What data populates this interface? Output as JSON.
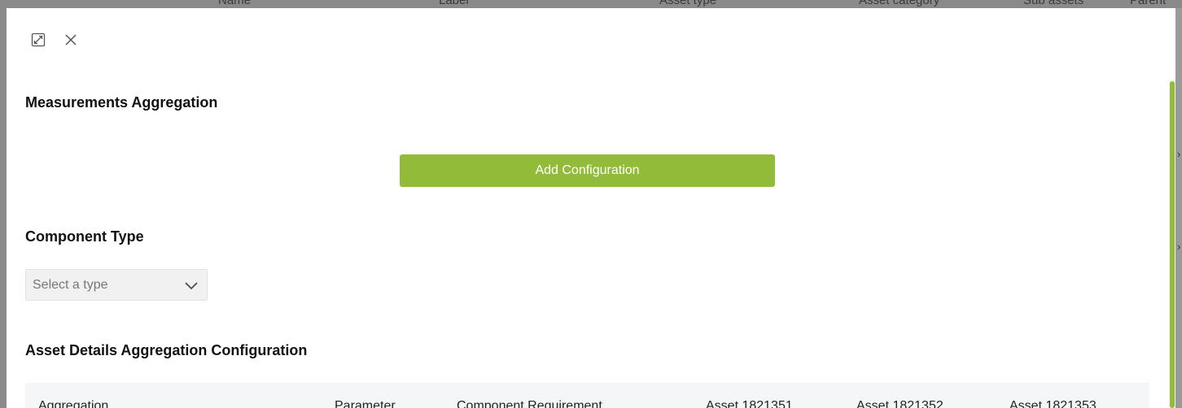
{
  "background_table": {
    "columns": [
      "Name",
      "Label",
      "Asset type",
      "Asset category",
      "Sub assets",
      "Parent"
    ]
  },
  "modal": {
    "expand_icon": "expand-icon",
    "close_icon": "close-icon",
    "measurements_title": "Measurements Aggregation",
    "add_config_label": "Add Configuration",
    "component_type_title": "Component Type",
    "component_type_select": {
      "placeholder": "Select a type",
      "icon": "chevron-down-icon"
    },
    "asset_details_title": "Asset Details Aggregation Configuration",
    "table": {
      "headers": [
        "Aggregation",
        "Parameter",
        "Component Requirement",
        "Asset 1821351",
        "Asset 1821352",
        "Asset 1821353"
      ]
    }
  },
  "colors": {
    "accent": "#93bb3a",
    "backdrop": "#8a8a8a",
    "table_header_bg": "#f4f6f8",
    "select_bg": "#f1f1f1"
  }
}
